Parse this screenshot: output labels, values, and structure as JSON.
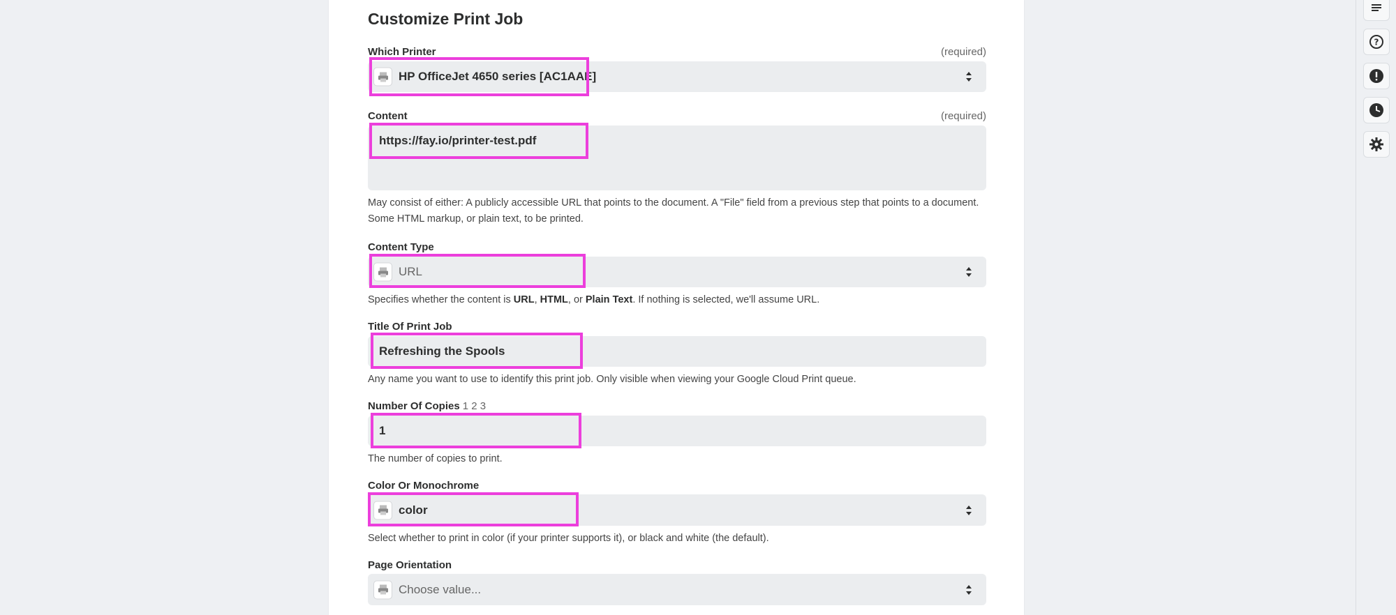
{
  "page_title": "Customize Print Job",
  "required_text": "(required)",
  "fields": {
    "printer": {
      "label": "Which Printer",
      "value": "HP OfficeJet 4650 series [AC1AAE]"
    },
    "content": {
      "label": "Content",
      "value": "https://fay.io/printer-test.pdf",
      "help": "May consist of either: A publicly accessible URL that points to the document. A \"File\" field from a previous step that points to a document. Some HTML markup, or plain text, to be printed."
    },
    "content_type": {
      "label": "Content Type",
      "placeholder": "URL",
      "help_prefix": "Specifies whether the content is ",
      "help_url": "URL",
      "help_sep1": ", ",
      "help_html": "HTML",
      "help_sep2": ", or ",
      "help_plain": "Plain Text",
      "help_suffix": ". If nothing is selected, we'll assume URL."
    },
    "title": {
      "label": "Title Of Print Job",
      "value": "Refreshing the Spools",
      "help": "Any name you want to use to identify this print job. Only visible when viewing your Google Cloud Print queue."
    },
    "copies": {
      "label": "Number Of Copies",
      "hint": "1 2 3",
      "value": "1",
      "help": "The number of copies to print."
    },
    "color": {
      "label": "Color Or Monochrome",
      "value": "color",
      "help": "Select whether to print in color (if your printer supports it), or black and white (the default)."
    },
    "orientation": {
      "label": "Page Orientation",
      "placeholder": "Choose value..."
    }
  },
  "rail_icons": [
    "list-icon",
    "help-circle-icon",
    "alert-icon",
    "clock-icon",
    "gear-icon"
  ],
  "colors": {
    "highlight": "#ec3fdc",
    "field_bg": "#ebedef",
    "page_bg": "#eef0f3"
  }
}
